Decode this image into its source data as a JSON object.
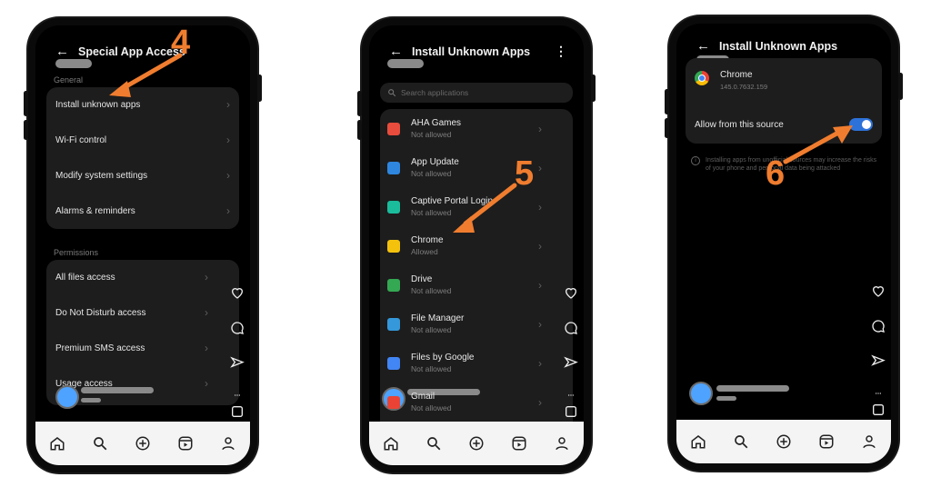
{
  "phone1": {
    "title": "Special App Access",
    "step": "4",
    "general_label": "General",
    "general_items": [
      "Install unknown apps",
      "Wi-Fi control",
      "Modify system settings",
      "Alarms & reminders"
    ],
    "permissions_label": "Permissions",
    "permission_items": [
      "All files access",
      "Do Not Disturb access",
      "Premium SMS access",
      "Usage access"
    ]
  },
  "phone2": {
    "title": "Install Unknown Apps",
    "step": "5",
    "search_placeholder": "Search applications",
    "apps": [
      {
        "name": "AHA Games",
        "status": "Not allowed",
        "color": "#e74c3c"
      },
      {
        "name": "App Update",
        "status": "Not allowed",
        "color": "#2e86de"
      },
      {
        "name": "Captive Portal Login",
        "status": "Not allowed",
        "color": "#1abc9c"
      },
      {
        "name": "Chrome",
        "status": "Allowed",
        "color": "#f4c20d"
      },
      {
        "name": "Drive",
        "status": "Not allowed",
        "color": "#34a853"
      },
      {
        "name": "File Manager",
        "status": "Not allowed",
        "color": "#3498db"
      },
      {
        "name": "Files by Google",
        "status": "Not allowed",
        "color": "#4285f4"
      },
      {
        "name": "Gmail",
        "status": "Not allowed",
        "color": "#ea4335"
      }
    ]
  },
  "phone3": {
    "title": "Install Unknown Apps",
    "step": "6",
    "app_name": "Chrome",
    "app_version": "145.0.7632.159",
    "allow_label": "Allow from this source",
    "allow_enabled": true,
    "warning": "Installing apps from unofficial sources may increase the risks of your phone and personal data being attacked"
  },
  "icons": [
    "back-arrow-icon",
    "chevron-right-icon",
    "search-icon",
    "heart-icon",
    "comment-icon",
    "send-icon",
    "more-icon",
    "save-icon",
    "home-icon",
    "create-icon",
    "reels-icon",
    "profile-icon",
    "info-icon",
    "kebab-menu-icon"
  ],
  "colors": {
    "annotation": "#f07d2f",
    "toggle_on": "#2d72d9",
    "avatar": "#4da3ff"
  }
}
